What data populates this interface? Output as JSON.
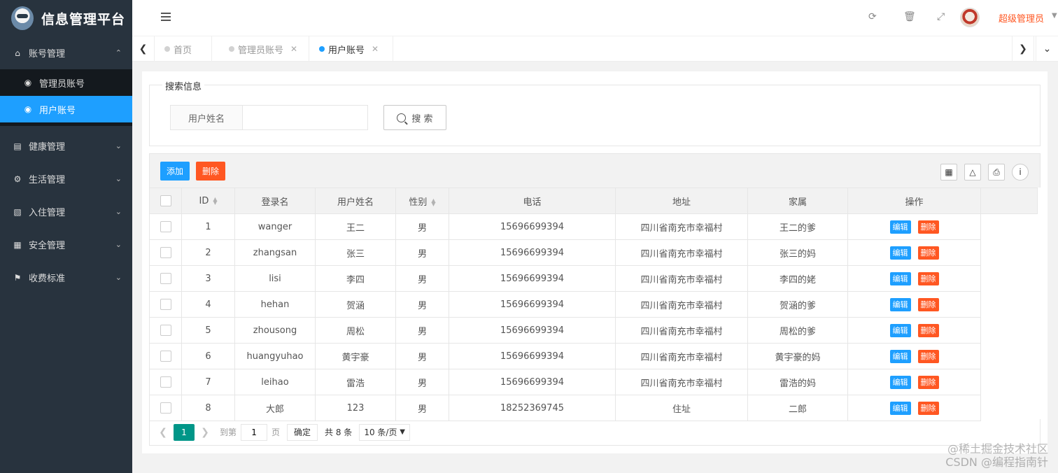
{
  "app": {
    "title": "信息管理平台"
  },
  "sidebar": {
    "groups": [
      {
        "label": "账号管理",
        "icon": "home-icon",
        "expanded": true,
        "items": [
          {
            "label": "管理员账号",
            "icon": "dashboard-icon",
            "active": false
          },
          {
            "label": "用户账号",
            "icon": "dashboard-icon",
            "active": true
          }
        ]
      },
      {
        "label": "健康管理",
        "icon": "card-icon"
      },
      {
        "label": "生活管理",
        "icon": "gears-icon"
      },
      {
        "label": "入住管理",
        "icon": "file-icon"
      },
      {
        "label": "安全管理",
        "icon": "calendar-icon"
      },
      {
        "label": "收费标准",
        "icon": "flag-icon"
      }
    ]
  },
  "header": {
    "icons": [
      "refresh-icon",
      "trash-icon",
      "fullscreen-icon"
    ],
    "user_name": "超级管理员"
  },
  "tabs": [
    {
      "label": "首页",
      "closable": false,
      "active": false
    },
    {
      "label": "管理员账号",
      "closable": true,
      "active": false
    },
    {
      "label": "用户账号",
      "closable": true,
      "active": true
    }
  ],
  "search": {
    "legend": "搜索信息",
    "field_label": "用户姓名",
    "field_value": "",
    "button_label": "搜 索"
  },
  "toolbar": {
    "add_label": "添加",
    "delete_label": "删除",
    "tool_icons": [
      "columns-icon",
      "export-icon",
      "print-icon",
      "info-icon"
    ]
  },
  "table": {
    "columns": [
      "ID",
      "登录名",
      "用户姓名",
      "性别",
      "电话",
      "地址",
      "家属",
      "操作"
    ],
    "edit_label": "编辑",
    "delete_label": "删除",
    "rows": [
      {
        "id": "1",
        "login": "wanger",
        "name": "王二",
        "gender": "男",
        "phone": "15696699394",
        "address": "四川省南充市幸福村",
        "family": "王二的爹"
      },
      {
        "id": "2",
        "login": "zhangsan",
        "name": "张三",
        "gender": "男",
        "phone": "15696699394",
        "address": "四川省南充市幸福村",
        "family": "张三的妈"
      },
      {
        "id": "3",
        "login": "lisi",
        "name": "李四",
        "gender": "男",
        "phone": "15696699394",
        "address": "四川省南充市幸福村",
        "family": "李四的姥"
      },
      {
        "id": "4",
        "login": "hehan",
        "name": "贺涵",
        "gender": "男",
        "phone": "15696699394",
        "address": "四川省南充市幸福村",
        "family": "贺涵的爹"
      },
      {
        "id": "5",
        "login": "zhousong",
        "name": "周松",
        "gender": "男",
        "phone": "15696699394",
        "address": "四川省南充市幸福村",
        "family": "周松的爹"
      },
      {
        "id": "6",
        "login": "huangyuhao",
        "name": "黄宇豪",
        "gender": "男",
        "phone": "15696699394",
        "address": "四川省南充市幸福村",
        "family": "黄宇豪的妈"
      },
      {
        "id": "7",
        "login": "leihao",
        "name": "雷浩",
        "gender": "男",
        "phone": "15696699394",
        "address": "四川省南充市幸福村",
        "family": "雷浩的妈"
      },
      {
        "id": "8",
        "login": "大郎",
        "name": "123",
        "gender": "男",
        "phone": "18252369745",
        "address": "住址",
        "family": "二郎"
      }
    ]
  },
  "pager": {
    "current": "1",
    "goto_label": "到第",
    "goto_value": "1",
    "page_unit": "页",
    "ok_label": "确定",
    "total_label": "共 8 条",
    "page_size": "10 条/页"
  },
  "watermark": {
    "line1": "@稀土掘金技术社区",
    "line2": "CSDN @编程指南针"
  }
}
